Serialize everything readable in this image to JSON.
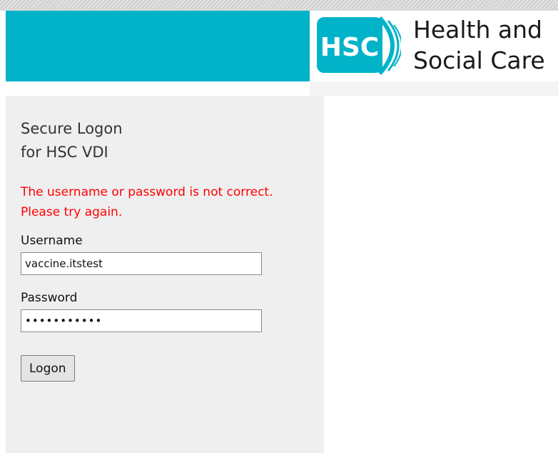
{
  "header": {
    "logo_abbreviation": "HSC",
    "logo_text_line1": "Health and",
    "logo_text_line2": "Social Care",
    "brand_color": "#00b3c9",
    "logo_icon": "hsc-logo-icon"
  },
  "login": {
    "title_line1": "Secure Logon",
    "title_line2": "for HSC VDI",
    "error_line1": "The username or password is not correct.",
    "error_line2": "Please try again.",
    "error_color": "#ff0000",
    "username_label": "Username",
    "username_value": "vaccine.itstest",
    "password_label": "Password",
    "password_value": "•••••••••••",
    "logon_button_label": "Logon"
  }
}
